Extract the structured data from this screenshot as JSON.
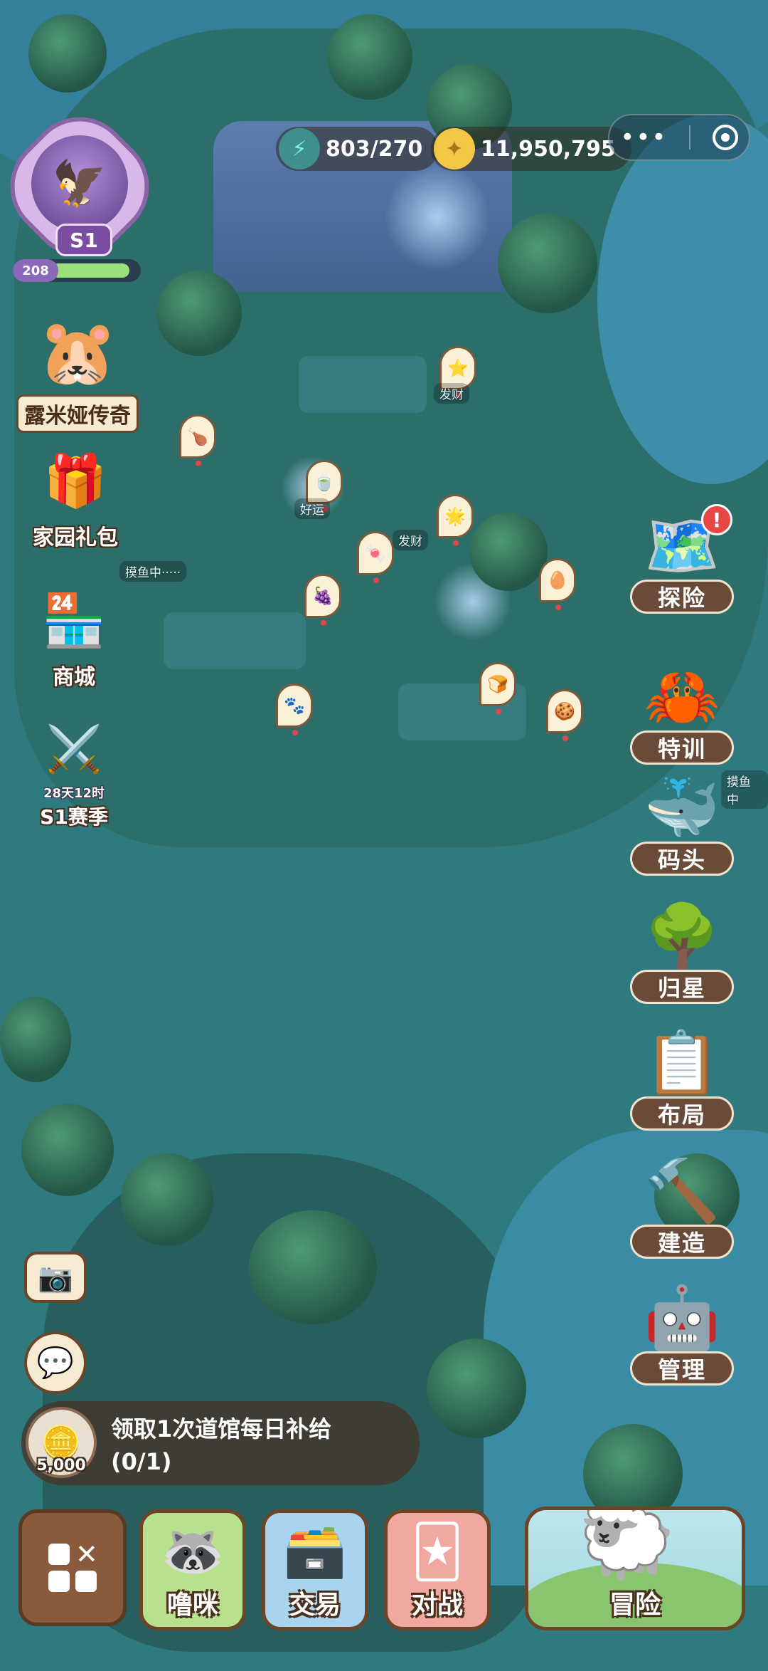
{
  "resources": {
    "energy_value": "803/270",
    "coins_value": "11,950,795"
  },
  "profile": {
    "season_tag": "S1",
    "level": "208",
    "level_progress": 0.9
  },
  "left_menu": [
    {
      "label": "露米娅传奇",
      "icon": "capybara-icon"
    },
    {
      "label": "家园礼包",
      "icon": "gift-icon"
    },
    {
      "label": "商城",
      "icon": "shop-icon"
    },
    {
      "label": "28天12时",
      "label2": "S1赛季",
      "icon": "sword-icon"
    }
  ],
  "right_menu": [
    {
      "label": "探险",
      "icon": "treasure-map-icon",
      "badge": "!"
    },
    {
      "label": "特训",
      "icon": "training-icon"
    },
    {
      "label": "码头",
      "icon": "whale-icon"
    },
    {
      "label": "归星",
      "icon": "star-tree-icon"
    },
    {
      "label": "布局",
      "icon": "layout-board-icon"
    },
    {
      "label": "建造",
      "icon": "hammer-icon"
    },
    {
      "label": "管理",
      "icon": "robot-manager-icon"
    }
  ],
  "scene_labels": {
    "fishing_1": "摸鱼中·····",
    "fishing_2": "摸鱼中",
    "tag_luck": "好运",
    "tag_rich": "发财",
    "tag_rich2": "发财"
  },
  "quest": {
    "title": "领取1次道馆每日补给",
    "progress": "(0/1)",
    "reward": "5,000"
  },
  "bottom_bar": {
    "pet": "噜咪",
    "trade": "交易",
    "battle": "对战",
    "adventure": "冒险"
  },
  "colors": {
    "ground": "#2f7a7e",
    "water": "#347f9a",
    "panel_brown": "#6b4528",
    "label_cream": "#f7ead2"
  }
}
